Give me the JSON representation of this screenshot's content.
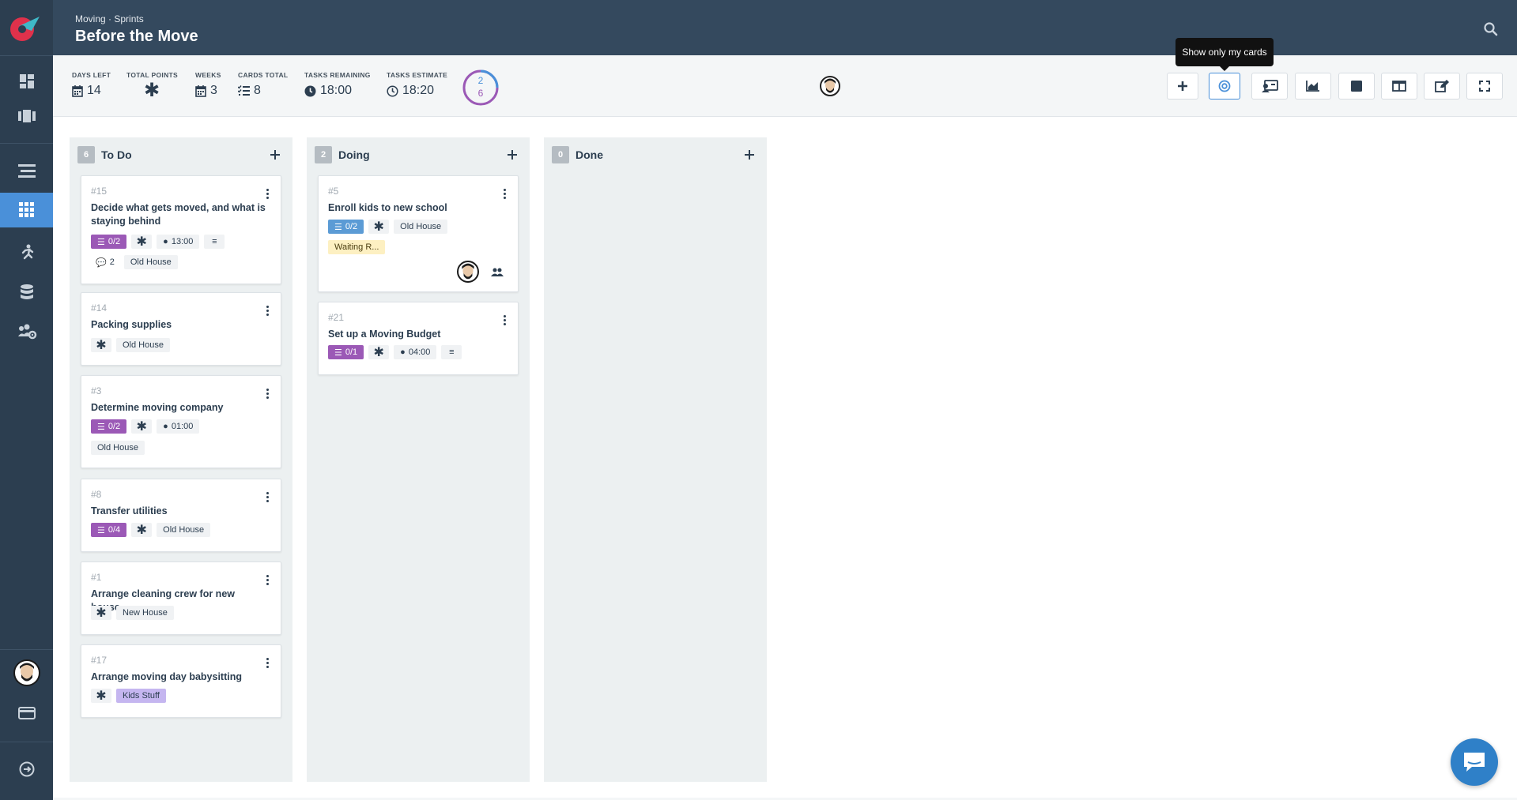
{
  "header": {
    "breadcrumb": "Moving · Sprints",
    "title": "Before the Move"
  },
  "stats": [
    {
      "label": "DAYS LEFT",
      "value": "14",
      "icon": "calendar-icon"
    },
    {
      "label": "TOTAL POINTS",
      "value": "",
      "icon": "asterisk-icon"
    },
    {
      "label": "WEEKS",
      "value": "3",
      "icon": "calendar-icon"
    },
    {
      "label": "CARDS TOTAL",
      "value": "8",
      "icon": "checklist-icon"
    },
    {
      "label": "TASKS REMAINING",
      "value": "18:00",
      "icon": "clock-icon"
    },
    {
      "label": "TASKS ESTIMATE",
      "value": "18:20",
      "icon": "clock-icon"
    }
  ],
  "ring": {
    "top": "2",
    "bottom": "6"
  },
  "toolbar": {
    "tooltip": "Show only my cards",
    "buttons": [
      "add-icon",
      "target-icon",
      "assign-user-icon",
      "chart-icon",
      "square-icon",
      "columns-icon",
      "edit-icon",
      "fullscreen-icon"
    ]
  },
  "columns": [
    {
      "name": "To Do",
      "count": "6",
      "cards": [
        {
          "num": "#15",
          "title": "Decide what gets moved, and what is staying behind",
          "checklist": "0/2",
          "time": "13:00",
          "comments": "2",
          "tag": "Old House"
        },
        {
          "num": "#14",
          "title": "Packing supplies",
          "tag": "Old House"
        },
        {
          "num": "#3",
          "title": "Determine moving company",
          "checklist": "0/2",
          "time": "01:00",
          "tag": "Old House"
        },
        {
          "num": "#8",
          "title": "Transfer utilities",
          "checklist": "0/4",
          "tag": "Old House"
        },
        {
          "num": "#1",
          "title": "Arrange cleaning crew for new house",
          "tag": "New House"
        },
        {
          "num": "#17",
          "title": "Arrange moving day babysitting",
          "tag": "Kids Stuff"
        }
      ]
    },
    {
      "name": "Doing",
      "count": "2",
      "cards": [
        {
          "num": "#5",
          "title": "Enroll kids to new school",
          "checklist": "0/2",
          "tag": "Old House",
          "status": "Waiting R..."
        },
        {
          "num": "#21",
          "title": "Set up a Moving Budget",
          "checklist": "0/1",
          "time": "04:00"
        }
      ]
    },
    {
      "name": "Done",
      "count": "0",
      "cards": []
    }
  ],
  "colors": {
    "accent": "#4a90d9",
    "sidebar": "#2c3e50",
    "header": "#34495e",
    "checklist": "#9b59b6",
    "logo": "#e0314b"
  }
}
